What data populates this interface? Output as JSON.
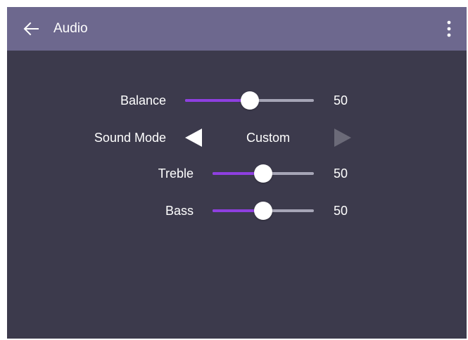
{
  "header": {
    "title": "Audio",
    "back_icon": "arrow-left-icon",
    "menu_icon": "more-vert-icon",
    "background": "#6d688e"
  },
  "colors": {
    "panel_background": "#3c3a4c",
    "slider_fill": "#8e3fe0",
    "slider_track": "#a6a5b6",
    "arrow_active": "#ffffff",
    "arrow_inactive": "#6b6a78"
  },
  "settings": {
    "balance": {
      "label": "Balance",
      "value": "50",
      "level": 0.5
    },
    "sound_mode": {
      "label": "Sound Mode",
      "value": "Custom",
      "prev_icon": "triangle-left-icon",
      "next_icon": "triangle-right-icon"
    },
    "treble": {
      "label": "Treble",
      "value": "50",
      "level": 0.5
    },
    "bass": {
      "label": "Bass",
      "value": "50",
      "level": 0.5
    }
  }
}
